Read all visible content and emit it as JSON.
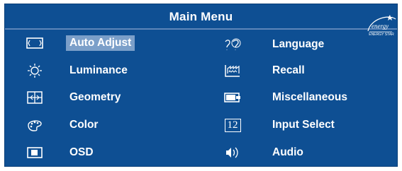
{
  "menu": {
    "title": "Main Menu",
    "logo_text": "ENERGY STAR",
    "left_items": [
      {
        "label": "Auto Adjust",
        "icon": "auto-adjust-icon",
        "selected": true
      },
      {
        "label": "Luminance",
        "icon": "sun-icon",
        "selected": false
      },
      {
        "label": "Geometry",
        "icon": "geometry-icon",
        "selected": false
      },
      {
        "label": "Color",
        "icon": "palette-icon",
        "selected": false
      },
      {
        "label": "OSD",
        "icon": "osd-icon",
        "selected": false
      }
    ],
    "right_items": [
      {
        "label": "Language",
        "icon": "language-icon",
        "selected": false
      },
      {
        "label": "Recall",
        "icon": "recall-icon",
        "selected": false
      },
      {
        "label": "Miscellaneous",
        "icon": "miscellaneous-icon",
        "selected": false
      },
      {
        "label": "Input Select",
        "icon": "input-select-icon",
        "icon_text": "12",
        "selected": false
      },
      {
        "label": "Audio",
        "icon": "audio-icon",
        "selected": false
      }
    ]
  },
  "colors": {
    "background": "#0e4f93",
    "highlight": "#7b9fc9",
    "text": "#ffffff"
  }
}
